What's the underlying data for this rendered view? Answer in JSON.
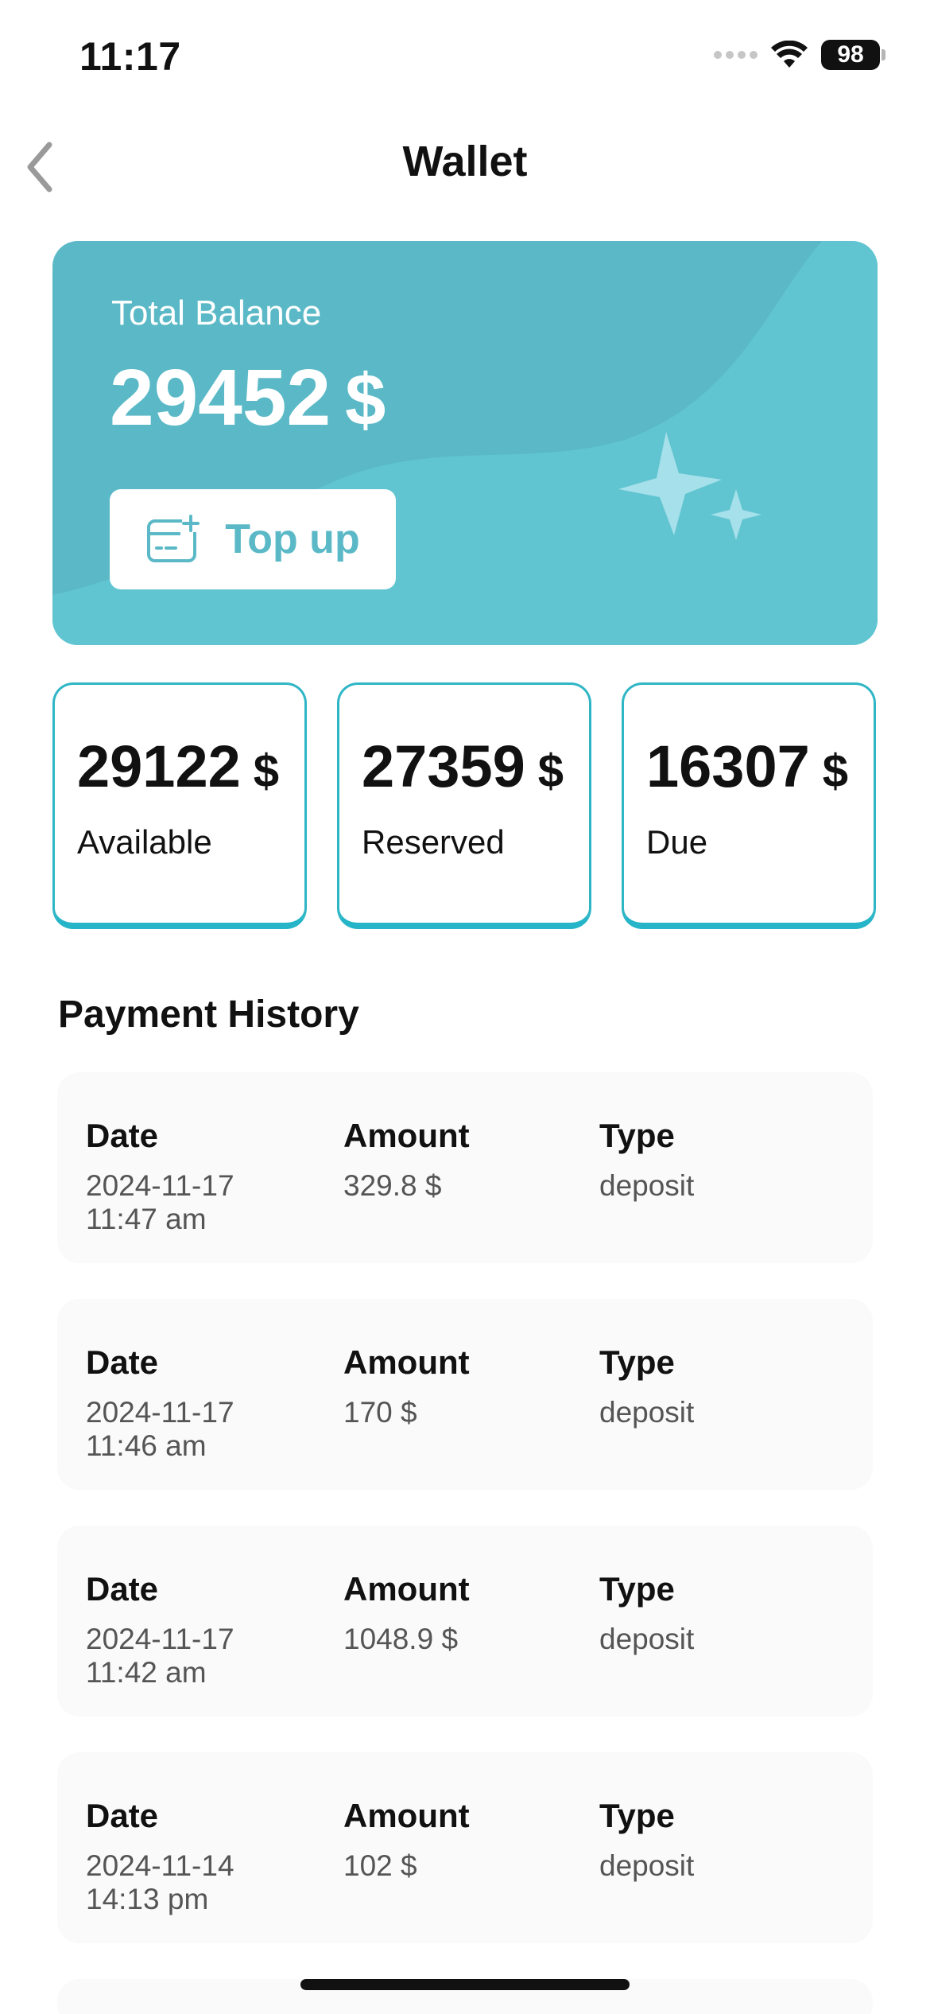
{
  "status_bar": {
    "time": "11:17",
    "battery": "98"
  },
  "nav": {
    "title": "Wallet"
  },
  "balance_card": {
    "label": "Total Balance",
    "amount": "29452",
    "currency": "$",
    "topup_label": "Top up",
    "color": "#5bb9c7"
  },
  "stats": [
    {
      "value": "29122",
      "currency": "$",
      "label": "Available"
    },
    {
      "value": "27359",
      "currency": "$",
      "label": "Reserved"
    },
    {
      "value": "16307",
      "currency": "$",
      "label": "Due"
    }
  ],
  "payment_history": {
    "title": "Payment History",
    "headers": {
      "date": "Date",
      "amount": "Amount",
      "type": "Type"
    },
    "items": [
      {
        "date": "2024-11-17",
        "time": "11:47 am",
        "amount": "329.8 $",
        "type": "deposit"
      },
      {
        "date": "2024-11-17",
        "time": "11:46 am",
        "amount": "170 $",
        "type": "deposit"
      },
      {
        "date": "2024-11-17",
        "time": "11:42 am",
        "amount": "1048.9 $",
        "type": "deposit"
      },
      {
        "date": "2024-11-14",
        "time": "14:13 pm",
        "amount": "102 $",
        "type": "deposit"
      }
    ]
  },
  "icons": {
    "back": "chevron-left-icon",
    "wifi": "wifi-icon",
    "topup": "wallet-add-icon"
  }
}
